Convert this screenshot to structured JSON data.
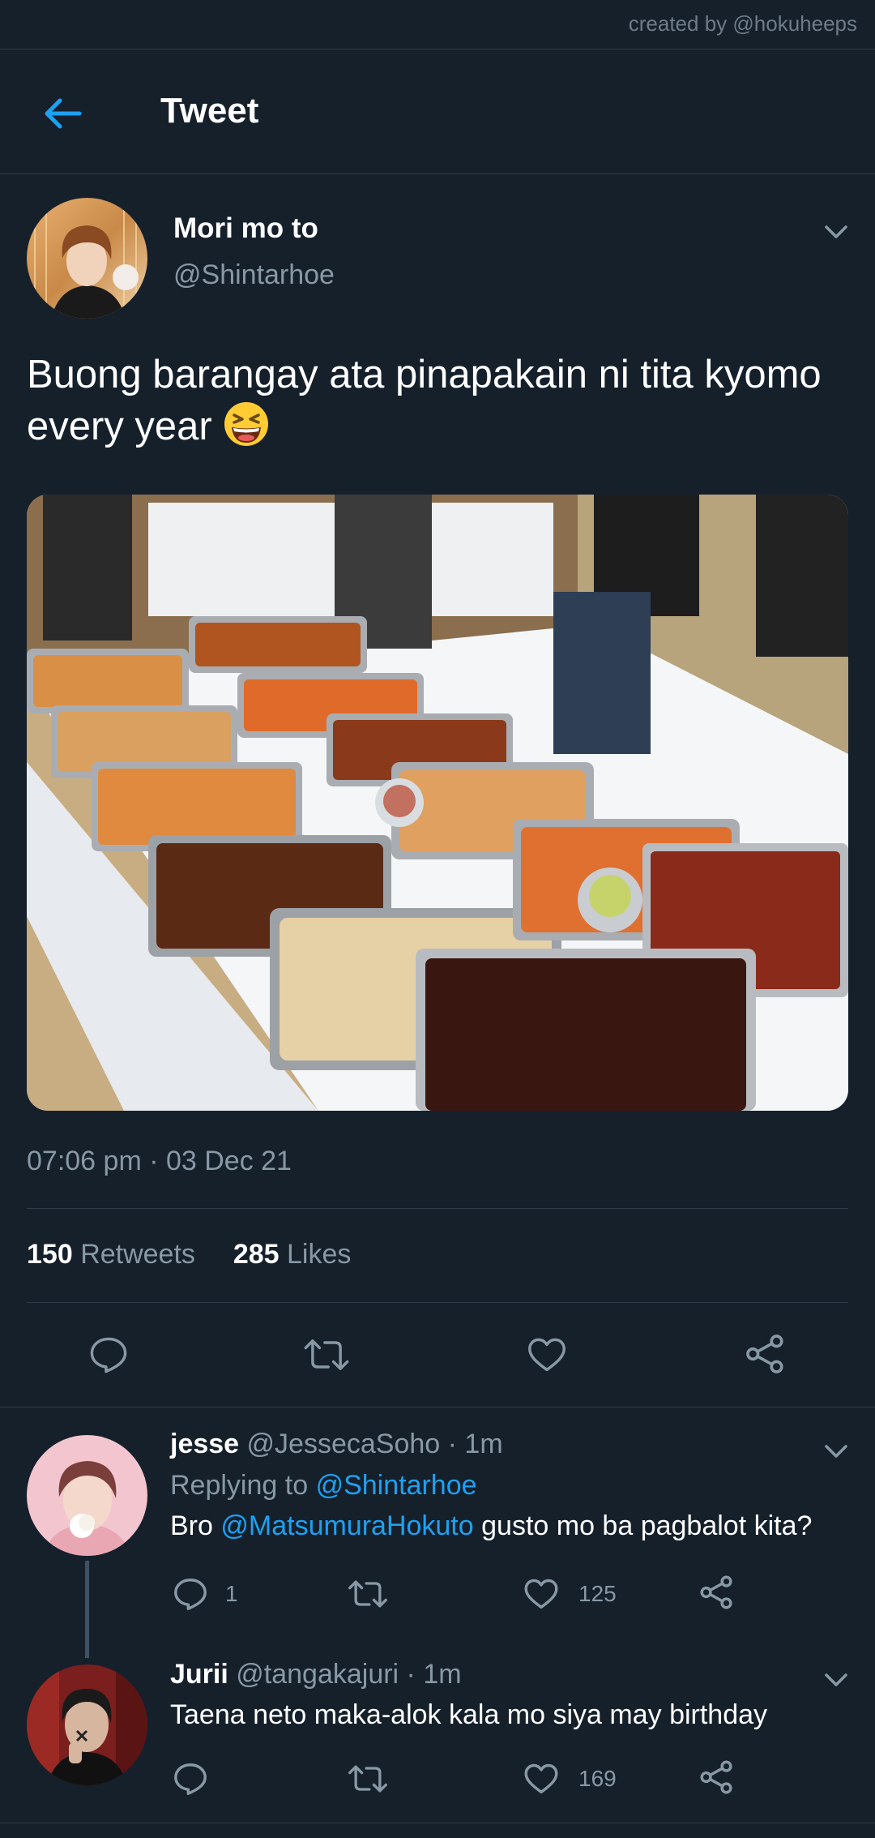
{
  "credit": "created by @hokuheeps",
  "header": {
    "title": "Tweet"
  },
  "tweet": {
    "name": "Mori mo to",
    "handle": "@Shintarhoe",
    "text": "Buong barangay ata pinapakain ni tita kyomo every year",
    "emoji": "grinning-squinting-face",
    "timestamp": "07:06 pm · 03 Dec 21",
    "retweets_count": "150",
    "retweets_label": "Retweets",
    "likes_count": "285",
    "likes_label": "Likes"
  },
  "replies": [
    {
      "name": "jesse",
      "meta": "@JessecaSoho · 1m",
      "replying_prefix": "Replying to",
      "replying_handle": "@Shintarhoe",
      "text_prefix": "Bro",
      "mention": "@MatsumuraHokuto",
      "text_suffix": "gusto mo ba pagbalot kita?",
      "reply_count": "1",
      "like_count": "125"
    },
    {
      "name": "Jurii",
      "meta": "@tangakajuri · 1m",
      "text": "Taena neto maka-alok kala mo siya may birthday",
      "like_count": "169"
    }
  ],
  "colors": {
    "background": "#15202b",
    "accent": "#1da1f2",
    "muted": "#8899a6",
    "divider": "#2f3d4a"
  }
}
